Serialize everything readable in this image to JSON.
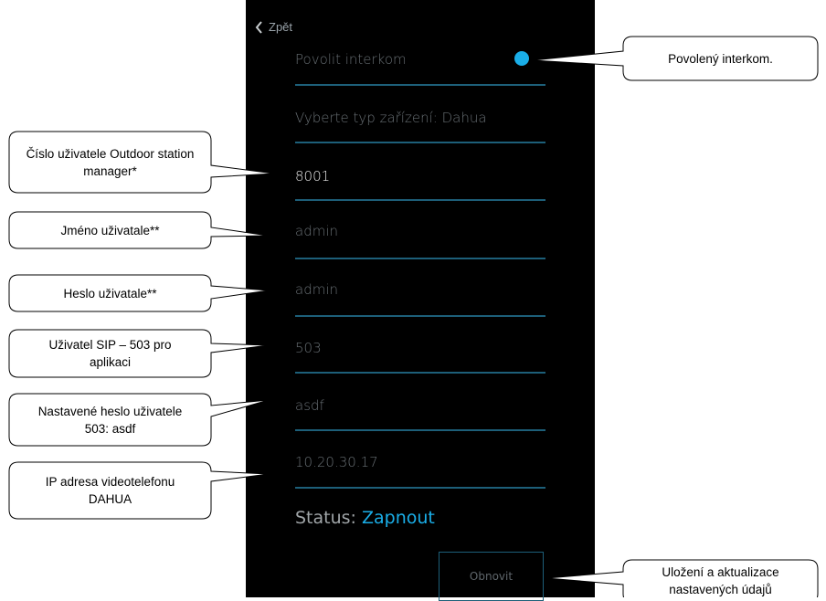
{
  "app": {
    "back_label": "Zpět",
    "enable_intercom_label": "Povolit interkom",
    "device_type_label": "Vyberte typ zařízení: Dahua",
    "fields": {
      "manager_number": "8001",
      "username": "admin",
      "password": "admin",
      "sip_user": "503",
      "sip_password": "asdf",
      "ip_address": "10.20.30.17"
    },
    "status_label": "Status:",
    "status_value": "Zapnout",
    "refresh_button": "Obnovit",
    "colors": {
      "accent": "#1aaee8",
      "line": "#1d5f79",
      "background": "#000000"
    }
  },
  "callouts": {
    "intercom_enabled": "Povolený interkom.",
    "manager_number": "Číslo uživatele Outdoor station manager*",
    "username": "Jméno uživatale**",
    "password": "Heslo uživatale**",
    "sip_user": "Uživatel SIP – 503 pro aplikaci",
    "sip_password": "Nastavené heslo uživatele 503: asdf",
    "ip_address": "IP adresa videotelefonu DAHUA",
    "save_update": "Uložení a aktualizace nastavených údajů"
  }
}
